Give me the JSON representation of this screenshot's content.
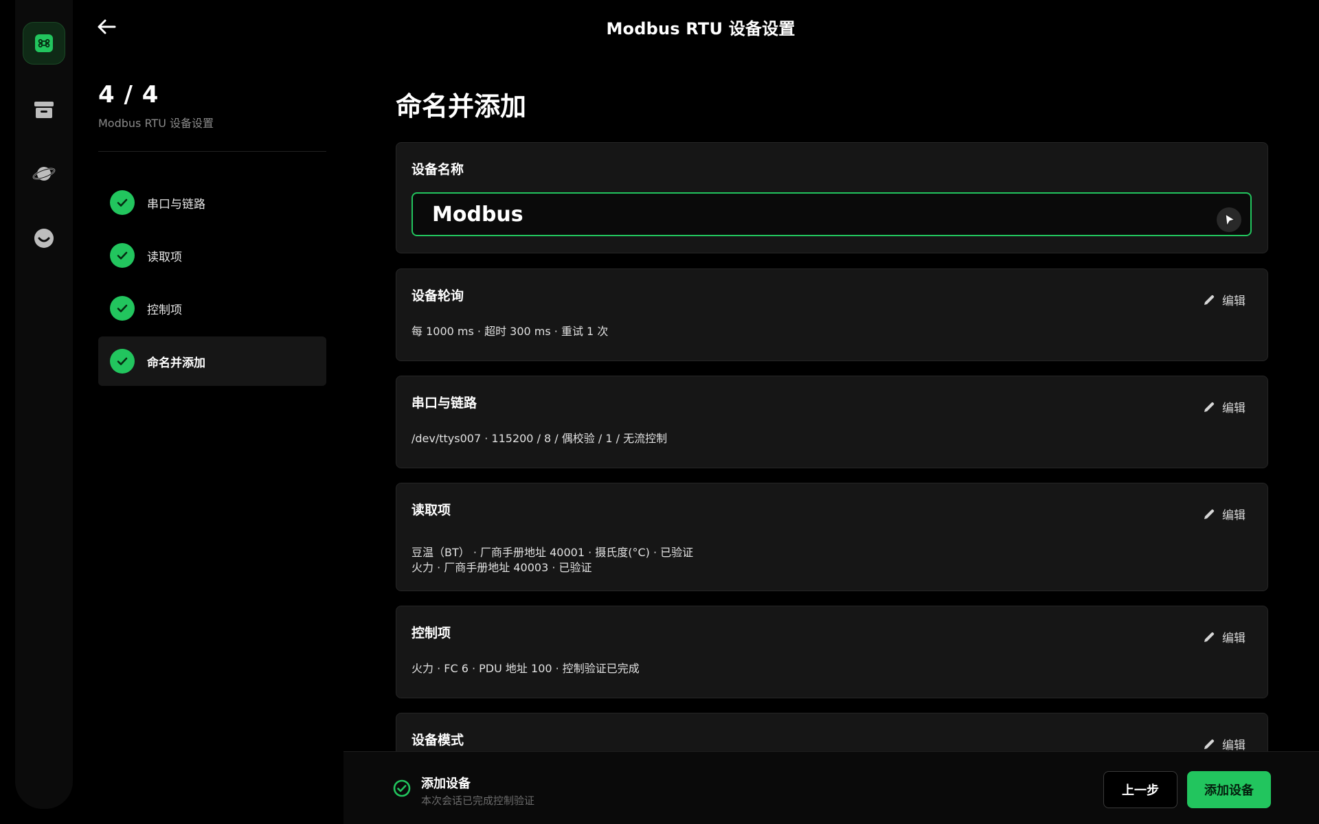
{
  "header": {
    "title": "Modbus RTU 设备设置",
    "back_icon": "arrow-left-icon"
  },
  "rail": {
    "items": [
      {
        "icon": "command-icon",
        "active": true
      },
      {
        "icon": "archive-box-icon",
        "active": false
      },
      {
        "icon": "planet-icon",
        "active": false
      },
      {
        "icon": "smiley-icon",
        "active": false
      }
    ]
  },
  "steps": {
    "count": "4 / 4",
    "subtitle": "Modbus RTU 设备设置",
    "items": [
      {
        "label": "串口与链路",
        "done": true
      },
      {
        "label": "读取项",
        "done": true
      },
      {
        "label": "控制项",
        "done": true
      },
      {
        "label": "命名并添加",
        "done": true,
        "current": true
      }
    ]
  },
  "main": {
    "title": "命名并添加",
    "name_card": {
      "label": "设备名称",
      "value": "Modbus"
    },
    "cards": [
      {
        "title": "设备轮询",
        "edit": "编辑",
        "lines": [
          "每 1000 ms · 超时 300 ms · 重试 1 次"
        ]
      },
      {
        "title": "串口与链路",
        "edit": "编辑",
        "lines": [
          "/dev/ttys007 · 115200 / 8 / 偶校验 / 1 / 无流控制"
        ]
      },
      {
        "title": "读取项",
        "edit": "编辑",
        "lines": [
          "豆温（BT） · 厂商手册地址 40001 · 摄氏度(°C) · 已验证",
          "火力 · 厂商手册地址 40003 · 已验证"
        ]
      },
      {
        "title": "控制项",
        "edit": "编辑",
        "lines": [
          "火力 · FC 6 · PDU 地址 100 · 控制验证已完成"
        ]
      },
      {
        "title": "设备模式",
        "edit": "编辑",
        "lines": []
      }
    ]
  },
  "footer": {
    "status_title": "添加设备",
    "status_sub": "本次会话已完成控制验证",
    "prev_label": "上一步",
    "add_label": "添加设备"
  },
  "colors": {
    "accent": "#22c55e",
    "card_bg": "#161616",
    "page_bg": "#000000"
  }
}
